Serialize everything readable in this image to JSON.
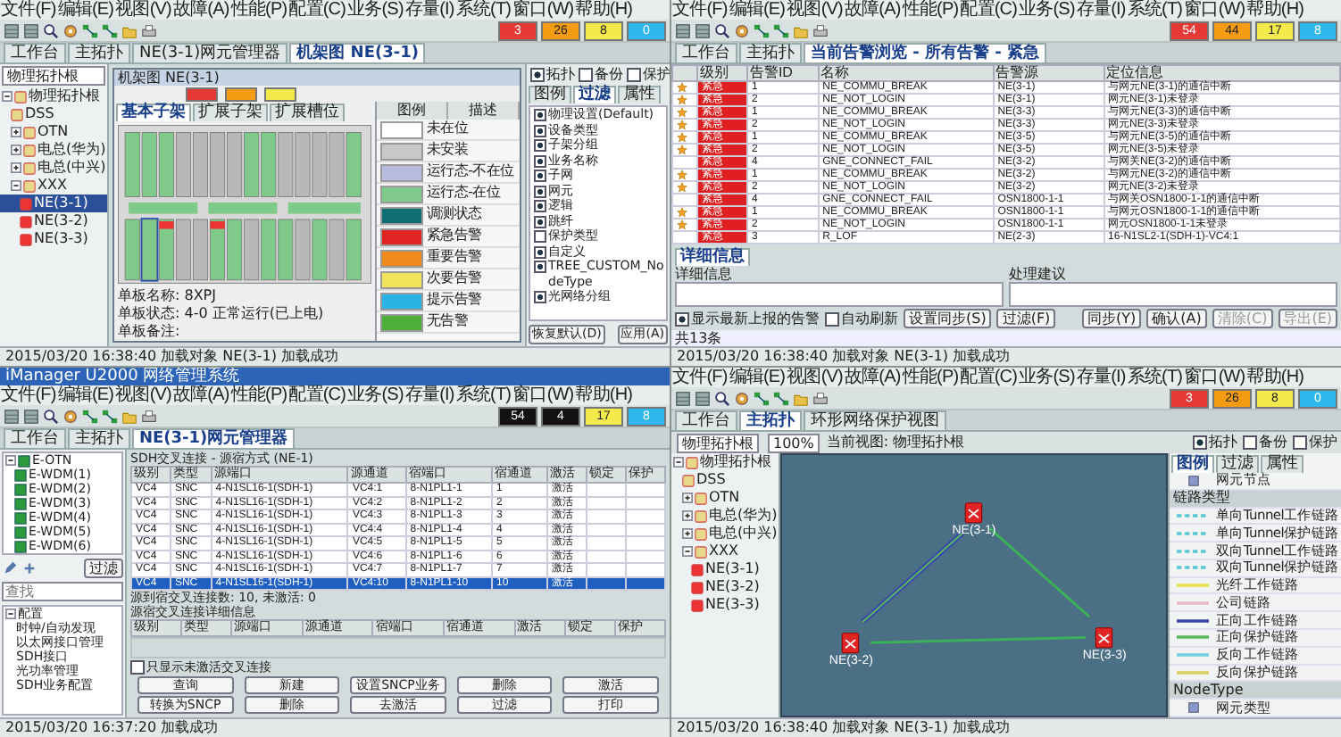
{
  "windows": [
    {
      "kind": "device",
      "menu": [
        "文件(F)",
        "编辑(E)",
        "视图(V)",
        "故障(A)",
        "性能(P)",
        "配置(C)",
        "业务(S)",
        "存量(I)",
        "系统(T)",
        "窗口(W)",
        "帮助(H)"
      ],
      "alarm_counts": [
        {
          "text": "3",
          "color": "#e53935"
        },
        {
          "text": "26",
          "color": "#f39c12"
        },
        {
          "text": "8",
          "color": "#f4ea4c"
        },
        {
          "text": "0",
          "color": "#2db7ea"
        }
      ],
      "tabs": [
        {
          "label": "工作台",
          "selected": false
        },
        {
          "label": "主拓扑",
          "selected": false
        },
        {
          "label": "NE(3-1)网元管理器",
          "selected": false
        },
        {
          "label": "机架图 NE(3-1)",
          "selected": true
        }
      ],
      "view_selector": "物理拓扑根",
      "tree": [
        {
          "label": "物理拓扑根",
          "expanded": true,
          "selected": false,
          "children": [
            {
              "label": "DSS",
              "selected": false
            },
            {
              "label": "OTN",
              "expanded": false,
              "selected": false
            },
            {
              "label": "电总(华为)",
              "expanded": false,
              "selected": false
            },
            {
              "label": "电总(中兴)",
              "expanded": false,
              "selected": false
            },
            {
              "label": "XXX",
              "expanded": true,
              "selected": false,
              "children": [
                {
                  "label": "NE(3-1)",
                  "selected": true
                },
                {
                  "label": "NE(3-2)",
                  "selected": false
                },
                {
                  "label": "NE(3-3)",
                  "selected": false
                }
              ]
            }
          ]
        }
      ],
      "rack_window": {
        "title": "机架图 NE(3-1)",
        "indicators": [
          {
            "color": "#e53935"
          },
          {
            "color": "#f39c12"
          },
          {
            "color": "#f4ea4c"
          }
        ],
        "subtabs": [
          {
            "label": "基本子架",
            "selected": true
          },
          {
            "label": "扩展子架",
            "selected": false
          },
          {
            "label": "扩展槽位",
            "selected": false
          }
        ],
        "legend_header": [
          "图例",
          "描述"
        ],
        "legend": [
          {
            "color": "#ffffff",
            "text": "未在位"
          },
          {
            "color": "#c8c8c8",
            "text": "未安装"
          },
          {
            "color": "#b8bde0",
            "text": "运行态-不在位"
          },
          {
            "color": "#7fc98a",
            "text": "运行态-在位"
          },
          {
            "color": "#0e6e73",
            "text": "调测状态"
          },
          {
            "color": "#e02424",
            "text": "紧急告警"
          },
          {
            "color": "#f08a1c",
            "text": "重要告警"
          },
          {
            "color": "#f2e35c",
            "text": "次要告警"
          },
          {
            "color": "#2ab4e6",
            "text": "提示告警"
          },
          {
            "color": "#4caf3a",
            "text": "无告警"
          }
        ],
        "info": [
          "单板名称: 8XPJ",
          "单板状态: 4-0 正常运行(已上电)",
          "单板备注:"
        ]
      },
      "top_checks": [
        {
          "label": "拓扑",
          "checked": true
        },
        {
          "label": "备份",
          "checked": false
        },
        {
          "label": "保护",
          "checked": false
        }
      ],
      "side_tabs": [
        {
          "label": "图例",
          "selected": false
        },
        {
          "label": "过滤",
          "selected": true
        },
        {
          "label": "属性",
          "selected": false
        }
      ],
      "filters": [
        {
          "label": "物理设置(Default)",
          "checked": true
        },
        {
          "label": "设备类型",
          "checked": true
        },
        {
          "label": "子架分组",
          "checked": true
        },
        {
          "label": "业务名称",
          "checked": true
        },
        {
          "label": "子网",
          "checked": true
        },
        {
          "label": "网元",
          "checked": true
        },
        {
          "label": "逻辑",
          "checked": true
        },
        {
          "label": "跳纤",
          "checked": true
        },
        {
          "label": "保护类型",
          "checked": false
        },
        {
          "label": "自定义",
          "checked": true
        },
        {
          "label": "TREE_CUSTOM_NodeType",
          "checked": true
        },
        {
          "label": "光网络分组",
          "checked": true
        }
      ],
      "buttons": [
        "恢复默认(D)",
        "应用(A)"
      ],
      "status": "2015/03/20 16:38:40 加载对象 NE(3-1) 加载成功"
    },
    {
      "kind": "alarms",
      "menu": [
        "文件(F)",
        "编辑(E)",
        "视图(V)",
        "故障(A)",
        "性能(P)",
        "配置(C)",
        "业务(S)",
        "存量(I)",
        "系统(T)",
        "窗口(W)",
        "帮助(H)"
      ],
      "alarm_counts": [
        {
          "text": "54",
          "color": "#e53935"
        },
        {
          "text": "44",
          "color": "#f39c12"
        },
        {
          "text": "17",
          "color": "#f4ea4c"
        },
        {
          "text": "8",
          "color": "#2db7ea"
        }
      ],
      "tabs": [
        {
          "label": "工作台",
          "selected": false
        },
        {
          "label": "主拓扑",
          "selected": false
        },
        {
          "label": "当前告警浏览 - 所有告警 - 紧急",
          "selected": true
        }
      ],
      "columns": [
        "级别",
        "告警ID",
        "名称",
        "告警源",
        "定位信息"
      ],
      "rows": [
        {
          "kind": "critical",
          "flagged": true,
          "cells": [
            "紧急",
            "1",
            "NE_COMMU_BREAK",
            "NE(3-1)",
            "与网元NE(3-1)的通信中断"
          ]
        },
        {
          "kind": "critical",
          "flagged": true,
          "cells": [
            "紧急",
            "2",
            "NE_NOT_LOGIN",
            "NE(3-1)",
            "网元NE(3-1)未登录"
          ]
        },
        {
          "kind": "critical",
          "flagged": true,
          "cells": [
            "紧急",
            "1",
            "NE_COMMU_BREAK",
            "NE(3-3)",
            "与网元NE(3-3)的通信中断"
          ]
        },
        {
          "kind": "critical",
          "flagged": true,
          "cells": [
            "紧急",
            "2",
            "NE_NOT_LOGIN",
            "NE(3-3)",
            "网元NE(3-3)未登录"
          ]
        },
        {
          "kind": "critical",
          "flagged": true,
          "cells": [
            "紧急",
            "1",
            "NE_COMMU_BREAK",
            "NE(3-5)",
            "与网元NE(3-5)的通信中断"
          ]
        },
        {
          "kind": "critical",
          "flagged": true,
          "cells": [
            "紧急",
            "2",
            "NE_NOT_LOGIN",
            "NE(3-5)",
            "网元NE(3-5)未登录"
          ]
        },
        {
          "kind": "critical",
          "flagged": false,
          "cells": [
            "紧急",
            "4",
            "GNE_CONNECT_FAIL",
            "NE(3-2)",
            "与网关NE(3-2)的通信中断"
          ]
        },
        {
          "kind": "critical",
          "flagged": true,
          "cells": [
            "紧急",
            "1",
            "NE_COMMU_BREAK",
            "NE(3-2)",
            "与网元NE(3-2)的通信中断"
          ]
        },
        {
          "kind": "critical",
          "flagged": true,
          "cells": [
            "紧急",
            "2",
            "NE_NOT_LOGIN",
            "NE(3-2)",
            "网元NE(3-2)未登录"
          ]
        },
        {
          "kind": "critical",
          "flagged": false,
          "cells": [
            "紧急",
            "4",
            "GNE_CONNECT_FAIL",
            "OSN1800-1-1",
            "与网关OSN1800-1-1的通信中断"
          ]
        },
        {
          "kind": "critical",
          "flagged": true,
          "cells": [
            "紧急",
            "1",
            "NE_COMMU_BREAK",
            "OSN1800-1-1",
            "与网元OSN1800-1-1的通信中断"
          ]
        },
        {
          "kind": "critical",
          "flagged": true,
          "cells": [
            "紧急",
            "2",
            "NE_NOT_LOGIN",
            "OSN1800-1-1",
            "网元OSN1800-1-1未登录"
          ]
        },
        {
          "kind": "critical",
          "flagged": false,
          "cells": [
            "紧急",
            "3",
            "R_LOF",
            "NE(2-3)",
            "16-N1SL2-1(SDH-1)-VC4:1"
          ]
        }
      ],
      "detail_tab": "详细信息",
      "panels": [
        "详细信息",
        "处理建议"
      ],
      "checks": [
        {
          "label": "显示最新上报的告警",
          "checked": true
        },
        {
          "label": "自动刷新",
          "checked": false
        }
      ],
      "left_buttons": [
        "设置同步(S)",
        "过滤(F)"
      ],
      "right_buttons": [
        {
          "label": "同步(Y)",
          "disabled": false
        },
        {
          "label": "确认(A)",
          "disabled": false
        },
        {
          "label": "清除(C)",
          "disabled": true
        },
        {
          "label": "导出(E)",
          "disabled": true
        }
      ],
      "count_line": "共13条",
      "status": "2015/03/20 16:38:40 加载对象 NE(3-1) 加载成功"
    },
    {
      "kind": "services",
      "title": "iManager U2000 网络管理系统",
      "menu": [
        "文件(F)",
        "编辑(E)",
        "视图(V)",
        "故障(A)",
        "性能(P)",
        "配置(C)",
        "业务(S)",
        "存量(I)",
        "系统(T)",
        "窗口(W)",
        "帮助(H)"
      ],
      "alarm_counts": [
        {
          "text": "54",
          "color": "#111111"
        },
        {
          "text": "4",
          "color": "#111111"
        },
        {
          "text": "17",
          "color": "#f4ea4c"
        },
        {
          "text": "8",
          "color": "#2db7ea"
        }
      ],
      "tabs": [
        {
          "label": "工作台",
          "selected": false
        },
        {
          "label": "主拓扑",
          "selected": false
        },
        {
          "label": "NE(3-1)网元管理器",
          "selected": true
        }
      ],
      "ne_tree": [
        {
          "label": "E-OTN",
          "expanded": true,
          "selected": false,
          "children": [
            {
              "label": "E-WDM(1)",
              "selected": false
            },
            {
              "label": "E-WDM(2)",
              "selected": false
            },
            {
              "label": "E-WDM(3)",
              "selected": false
            },
            {
              "label": "E-WDM(4)",
              "selected": false
            },
            {
              "label": "E-WDM(5)",
              "selected": false
            },
            {
              "label": "E-WDM(6)",
              "selected": false
            }
          ]
        }
      ],
      "ne_button": "过滤",
      "search_placeholder": "查找",
      "function_tree": [
        {
          "label": "配置",
          "expanded": true,
          "selected": false,
          "children": [
            {
              "label": "时钟/自动发现",
              "selected": false
            },
            {
              "label": "以太网接口管理",
              "selected": false
            },
            {
              "label": "SDH接口",
              "selected": false
            },
            {
              "label": "光功率管理",
              "selected": false
            },
            {
              "label": "SDH业务配置",
              "selected": false
            }
          ]
        }
      ],
      "caption": "SDH交叉连接 - 源宿方式 (NE-1)",
      "columns": [
        "级别",
        "类型",
        "源端口",
        "源通道",
        "宿端口",
        "宿通道",
        "激活",
        "锁定",
        "保护"
      ],
      "rows": [
        {
          "selected": false,
          "cells": [
            "VC4",
            "SNC",
            "4-N1SL16-1(SDH-1)",
            "VC4:1",
            "8-N1PL1-1",
            "1",
            "激活"
          ]
        },
        {
          "selected": false,
          "cells": [
            "VC4",
            "SNC",
            "4-N1SL16-1(SDH-1)",
            "VC4:2",
            "8-N1PL1-2",
            "2",
            "激活"
          ]
        },
        {
          "selected": false,
          "cells": [
            "VC4",
            "SNC",
            "4-N1SL16-1(SDH-1)",
            "VC4:3",
            "8-N1PL1-3",
            "3",
            "激活"
          ]
        },
        {
          "selected": false,
          "cells": [
            "VC4",
            "SNC",
            "4-N1SL16-1(SDH-1)",
            "VC4:4",
            "8-N1PL1-4",
            "4",
            "激活"
          ]
        },
        {
          "selected": false,
          "cells": [
            "VC4",
            "SNC",
            "4-N1SL16-1(SDH-1)",
            "VC4:5",
            "8-N1PL1-5",
            "5",
            "激活"
          ]
        },
        {
          "selected": false,
          "cells": [
            "VC4",
            "SNC",
            "4-N1SL16-1(SDH-1)",
            "VC4:6",
            "8-N1PL1-6",
            "6",
            "激活"
          ]
        },
        {
          "selected": false,
          "cells": [
            "VC4",
            "SNC",
            "4-N1SL16-1(SDH-1)",
            "VC4:7",
            "8-N1PL1-7",
            "7",
            "激活"
          ]
        },
        {
          "selected": true,
          "cells": [
            "VC4",
            "SNC",
            "4-N1SL16-1(SDH-1)",
            "VC4:10",
            "8-N1PL1-10",
            "10",
            "激活"
          ]
        }
      ],
      "summary": "源到宿交叉连接数: 10, 未激活: 0",
      "detail_caption": "源宿交叉连接详细信息",
      "detail_columns": [
        "级别",
        "类型",
        "源端口",
        "源通道",
        "宿端口",
        "宿通道",
        "激活",
        "锁定",
        "保护"
      ],
      "only_inactive": {
        "label": "只显示未激活交叉连接",
        "checked": false
      },
      "buttons": [
        "查询",
        "新建",
        "设置SNCP业务",
        "删除",
        "激活",
        "转换为SNCP",
        "删除",
        "去激活",
        "过滤",
        "打印"
      ],
      "status": "2015/03/20 16:37:20 加载成功"
    },
    {
      "kind": "topology",
      "menu": [
        "文件(F)",
        "编辑(E)",
        "视图(V)",
        "故障(A)",
        "性能(P)",
        "配置(C)",
        "业务(S)",
        "存量(I)",
        "系统(T)",
        "窗口(W)",
        "帮助(H)"
      ],
      "alarm_counts": [
        {
          "text": "3",
          "color": "#e53935"
        },
        {
          "text": "26",
          "color": "#f39c12"
        },
        {
          "text": "8",
          "color": "#f4ea4c"
        },
        {
          "text": "0",
          "color": "#2db7ea"
        }
      ],
      "tabs": [
        {
          "label": "工作台",
          "selected": false
        },
        {
          "label": "主拓扑",
          "selected": true
        },
        {
          "label": "环形网络保护视图",
          "selected": false
        }
      ],
      "view_selector": "物理拓扑根",
      "zoom": "100%",
      "current_view": "当前视图: 物理拓扑根",
      "top_checks": [
        {
          "label": "拓扑",
          "checked": true
        },
        {
          "label": "备份",
          "checked": false
        },
        {
          "label": "保护",
          "checked": false
        }
      ],
      "tree": [
        {
          "label": "物理拓扑根",
          "expanded": true,
          "selected": false,
          "children": [
            {
              "label": "DSS",
              "selected": false
            },
            {
              "label": "OTN",
              "expanded": false,
              "selected": false
            },
            {
              "label": "电总(华为)",
              "expanded": false,
              "selected": false
            },
            {
              "label": "电总(中兴)",
              "expanded": false,
              "selected": false
            },
            {
              "label": "XXX",
              "expanded": true,
              "selected": false,
              "children": [
                {
                  "label": "NE(3-1)",
                  "selected": false
                },
                {
                  "label": "NE(3-2)",
                  "selected": false
                },
                {
                  "label": "NE(3-3)",
                  "selected": false
                }
              ]
            }
          ]
        }
      ],
      "nodes": [
        "NE(3-1)",
        "NE(3-2)",
        "NE(3-3)"
      ],
      "side_tabs": [
        {
          "label": "图例",
          "selected": true
        },
        {
          "label": "过滤",
          "selected": false
        },
        {
          "label": "属性",
          "selected": false
        }
      ],
      "legend": [
        {
          "kind": "node",
          "text": "网元节点"
        },
        {
          "kind": "section",
          "text": "链路类型"
        },
        {
          "kind": "dashed",
          "color": "#5bc8d8",
          "text": "单向Tunnel工作链路"
        },
        {
          "kind": "dashed",
          "color": "#5bc8d8",
          "text": "单向Tunnel保护链路"
        },
        {
          "kind": "dashed",
          "color": "#5bc8d8",
          "text": "双向Tunnel工作链路"
        },
        {
          "kind": "dashed",
          "color": "#5bc8d8",
          "text": "双向Tunnel保护链路"
        },
        {
          "kind": "line",
          "color": "#e8e04a",
          "text": "光纤工作链路"
        },
        {
          "kind": "line",
          "color": "#e6b8c8",
          "text": "公司链路"
        },
        {
          "kind": "line",
          "color": "#3a4aa8",
          "text": "正向工作链路"
        },
        {
          "kind": "line",
          "color": "#5cb85c",
          "text": "正向保护链路"
        },
        {
          "kind": "line",
          "color": "#6fd0e0",
          "text": "反向工作链路"
        },
        {
          "kind": "line",
          "color": "#d8d060",
          "text": "反向保护链路"
        },
        {
          "kind": "section",
          "text": "NodeType"
        },
        {
          "kind": "node",
          "text": "网元类型"
        }
      ],
      "status": "2015/03/20 16:38:40 加载对象 NE(3-1) 加载成功"
    }
  ]
}
